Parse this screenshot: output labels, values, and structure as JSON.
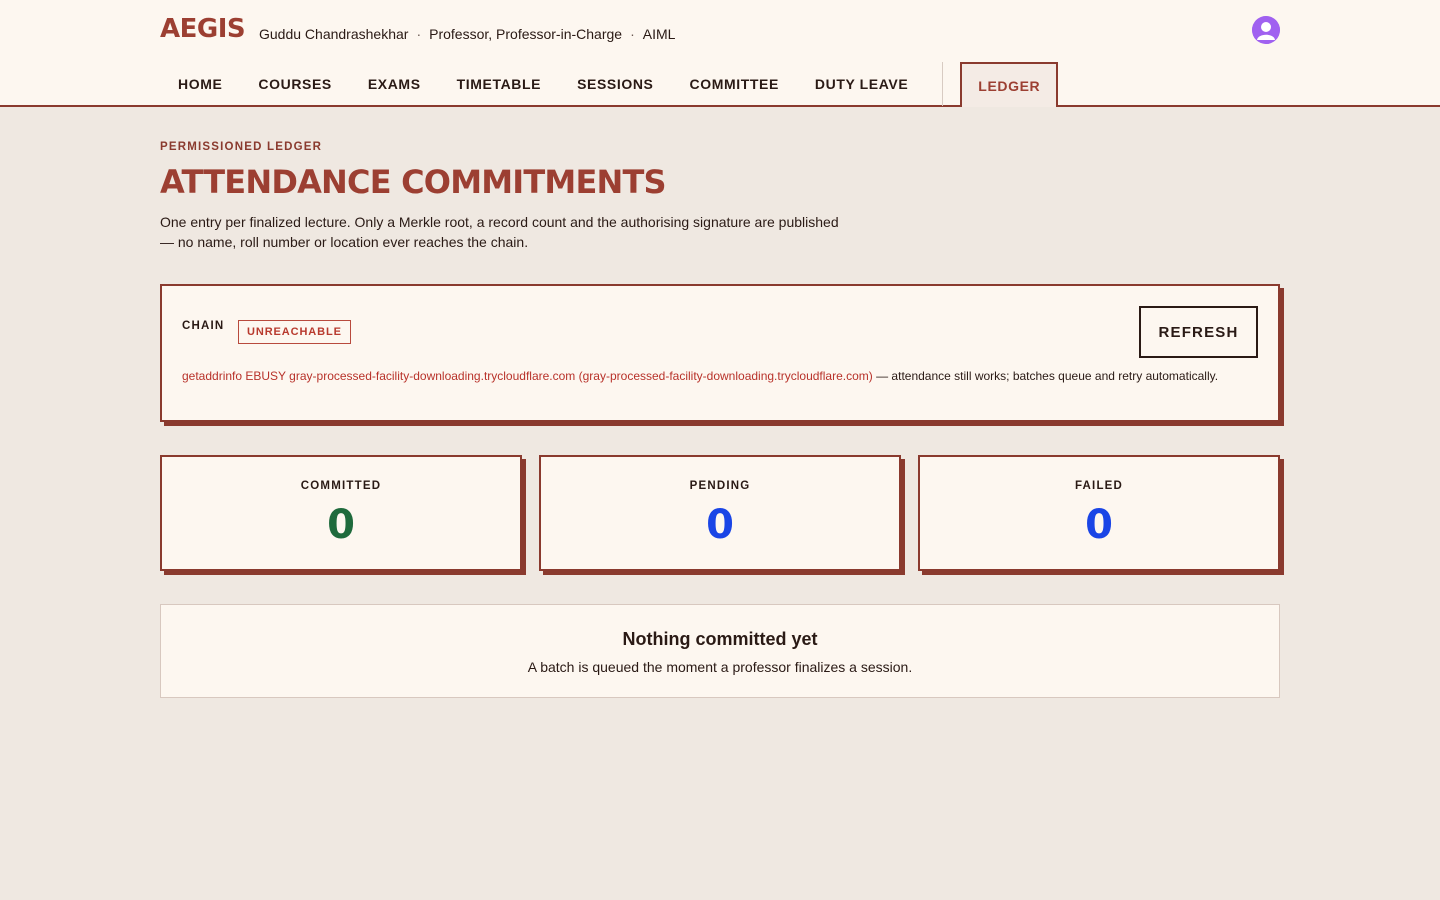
{
  "header": {
    "brand": "AEGIS",
    "user_name": "Guddu Chandrashekhar",
    "user_role": "Professor, Professor-in-Charge",
    "user_dept": "AIML",
    "separator": "·"
  },
  "nav": {
    "items": [
      {
        "label": "HOME"
      },
      {
        "label": "COURSES"
      },
      {
        "label": "EXAMS"
      },
      {
        "label": "TIMETABLE"
      },
      {
        "label": "SESSIONS"
      },
      {
        "label": "COMMITTEE"
      },
      {
        "label": "DUTY LEAVE"
      }
    ],
    "active": {
      "label": "LEDGER"
    }
  },
  "page": {
    "eyebrow": "PERMISSIONED LEDGER",
    "title": "ATTENDANCE COMMITMENTS",
    "description": "One entry per finalized lecture. Only a Merkle root, a record count and the authorising signature are published — no name, roll number or location ever reaches the chain."
  },
  "chain": {
    "label": "CHAIN",
    "status": "UNREACHABLE",
    "refresh_label": "REFRESH",
    "error": "getaddrinfo EBUSY gray-processed-facility-downloading.trycloudflare.com (gray-processed-facility-downloading.trycloudflare.com)",
    "note": " — attendance still works; batches queue and retry automatically."
  },
  "stats": {
    "committed": {
      "label": "COMMITTED",
      "value": "0"
    },
    "pending": {
      "label": "PENDING",
      "value": "0"
    },
    "failed": {
      "label": "FAILED",
      "value": "0"
    }
  },
  "empty": {
    "title": "Nothing committed yet",
    "subtitle": "A batch is queued the moment a professor finalizes a session."
  },
  "colors": {
    "brand": "#9c3f32",
    "committed": "#1e6a3c",
    "pending": "#1a45e6",
    "failed": "#1a45e6",
    "error": "#b8322a"
  }
}
